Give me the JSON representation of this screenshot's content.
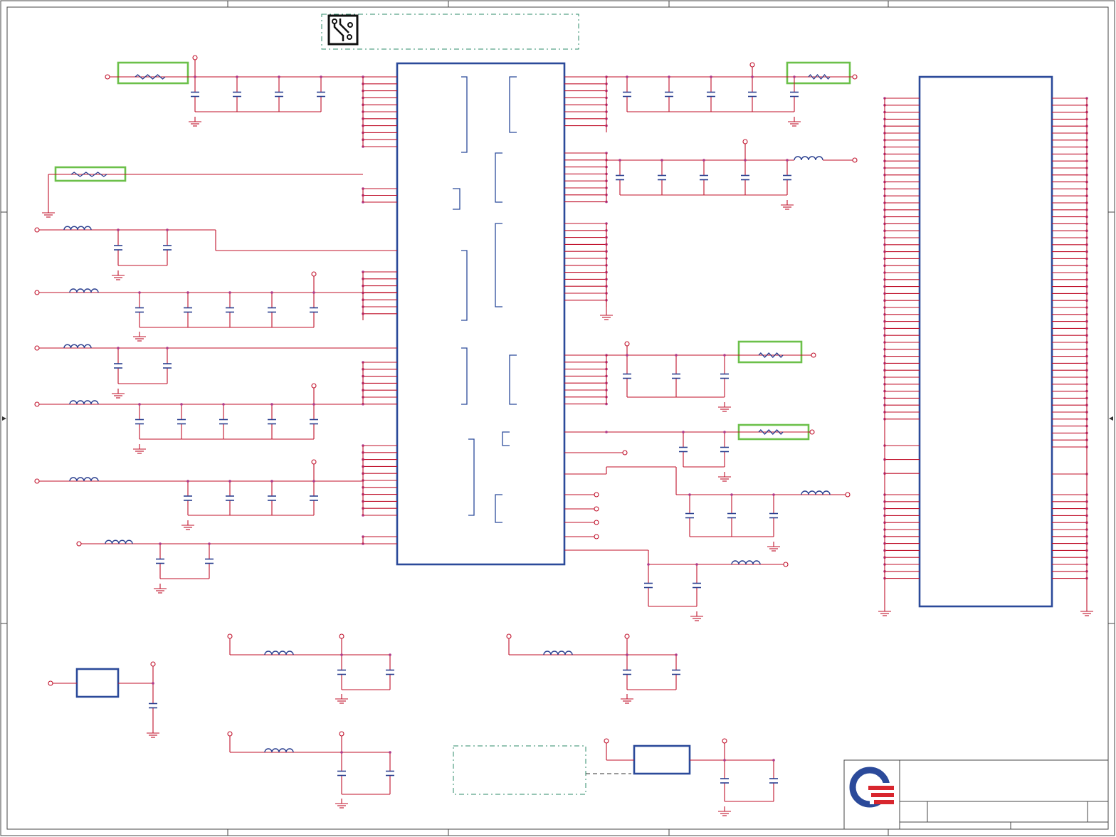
{
  "sheet": {
    "accent_wire": "#c0102a",
    "accent_component": "#2b4a9a",
    "accent_highlight": "#6cc04a",
    "accent_dashed": "#2e8b6a"
  },
  "title_block": {
    "logo": "company-logo",
    "logo_colors": [
      "#2b4a9a",
      "#d8262e"
    ]
  },
  "icons": {
    "pcb_symbol": "circuit-board-icon"
  }
}
